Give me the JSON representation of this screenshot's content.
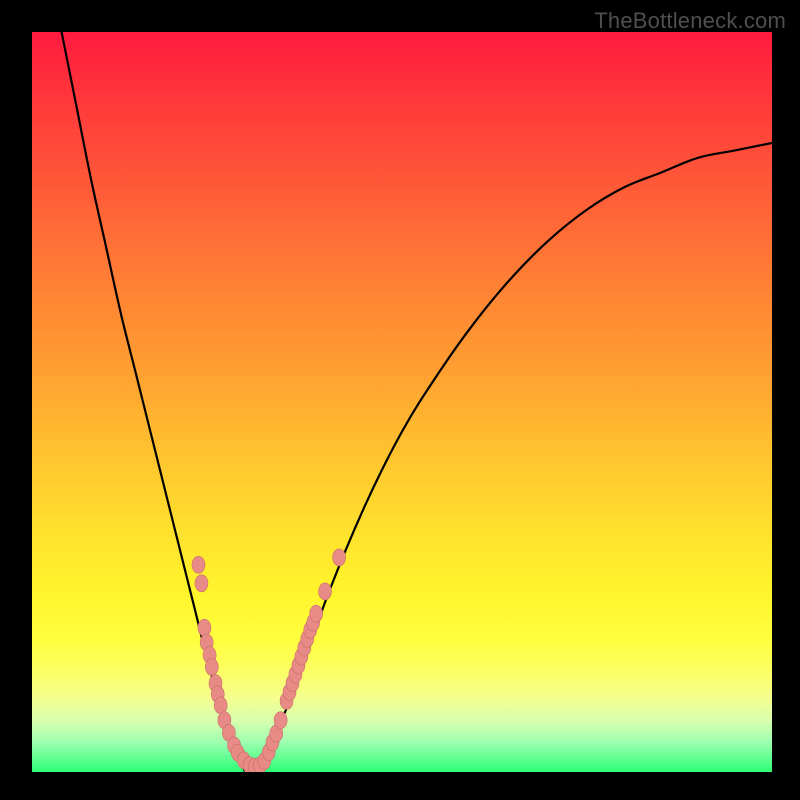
{
  "watermark": "TheBottleneck.com",
  "colors": {
    "frame": "#000000",
    "gradient_top": "#ff1a3e",
    "gradient_bottom": "#2cff74",
    "curve": "#000000",
    "bead_fill": "#e88a86",
    "bead_stroke": "#c96f6b"
  },
  "chart_data": {
    "type": "line",
    "title": "",
    "xlabel": "",
    "ylabel": "",
    "xlim": [
      0,
      100
    ],
    "ylim": [
      0,
      100
    ],
    "grid": false,
    "legend": false,
    "series": [
      {
        "name": "bottleneck-curve",
        "x": [
          4,
          6,
          8,
          10,
          12,
          14,
          16,
          18,
          20,
          22,
          24,
          26,
          28,
          30,
          35,
          40,
          45,
          50,
          55,
          60,
          65,
          70,
          75,
          80,
          85,
          90,
          95,
          100
        ],
        "y": [
          100,
          90,
          80,
          71,
          62,
          54,
          46,
          38,
          30,
          22,
          14,
          7,
          2,
          0,
          10,
          24,
          36,
          46,
          54,
          61,
          67,
          72,
          76,
          79,
          81,
          83,
          84,
          85
        ]
      }
    ],
    "markers": {
      "name": "bead-cluster",
      "points": [
        {
          "x": 22.5,
          "y": 28.0
        },
        {
          "x": 22.9,
          "y": 25.5
        },
        {
          "x": 23.3,
          "y": 19.5
        },
        {
          "x": 23.6,
          "y": 17.5
        },
        {
          "x": 24.0,
          "y": 15.8
        },
        {
          "x": 24.3,
          "y": 14.2
        },
        {
          "x": 24.8,
          "y": 12.0
        },
        {
          "x": 25.1,
          "y": 10.5
        },
        {
          "x": 25.5,
          "y": 9.0
        },
        {
          "x": 26.0,
          "y": 7.0
        },
        {
          "x": 26.6,
          "y": 5.3
        },
        {
          "x": 27.3,
          "y": 3.6
        },
        {
          "x": 27.8,
          "y": 2.6
        },
        {
          "x": 28.6,
          "y": 1.6
        },
        {
          "x": 29.4,
          "y": 0.9
        },
        {
          "x": 30.1,
          "y": 0.7
        },
        {
          "x": 30.8,
          "y": 0.9
        },
        {
          "x": 31.4,
          "y": 1.5
        },
        {
          "x": 32.0,
          "y": 2.7
        },
        {
          "x": 32.5,
          "y": 4.0
        },
        {
          "x": 33.0,
          "y": 5.2
        },
        {
          "x": 33.6,
          "y": 7.0
        },
        {
          "x": 34.4,
          "y": 9.6
        },
        {
          "x": 34.8,
          "y": 10.8
        },
        {
          "x": 35.2,
          "y": 12.0
        },
        {
          "x": 35.6,
          "y": 13.2
        },
        {
          "x": 36.0,
          "y": 14.4
        },
        {
          "x": 36.4,
          "y": 15.6
        },
        {
          "x": 36.8,
          "y": 16.8
        },
        {
          "x": 37.2,
          "y": 18.0
        },
        {
          "x": 37.6,
          "y": 19.2
        },
        {
          "x": 38.0,
          "y": 20.2
        },
        {
          "x": 38.4,
          "y": 21.4
        },
        {
          "x": 39.6,
          "y": 24.4
        },
        {
          "x": 41.5,
          "y": 29.0
        }
      ]
    }
  }
}
